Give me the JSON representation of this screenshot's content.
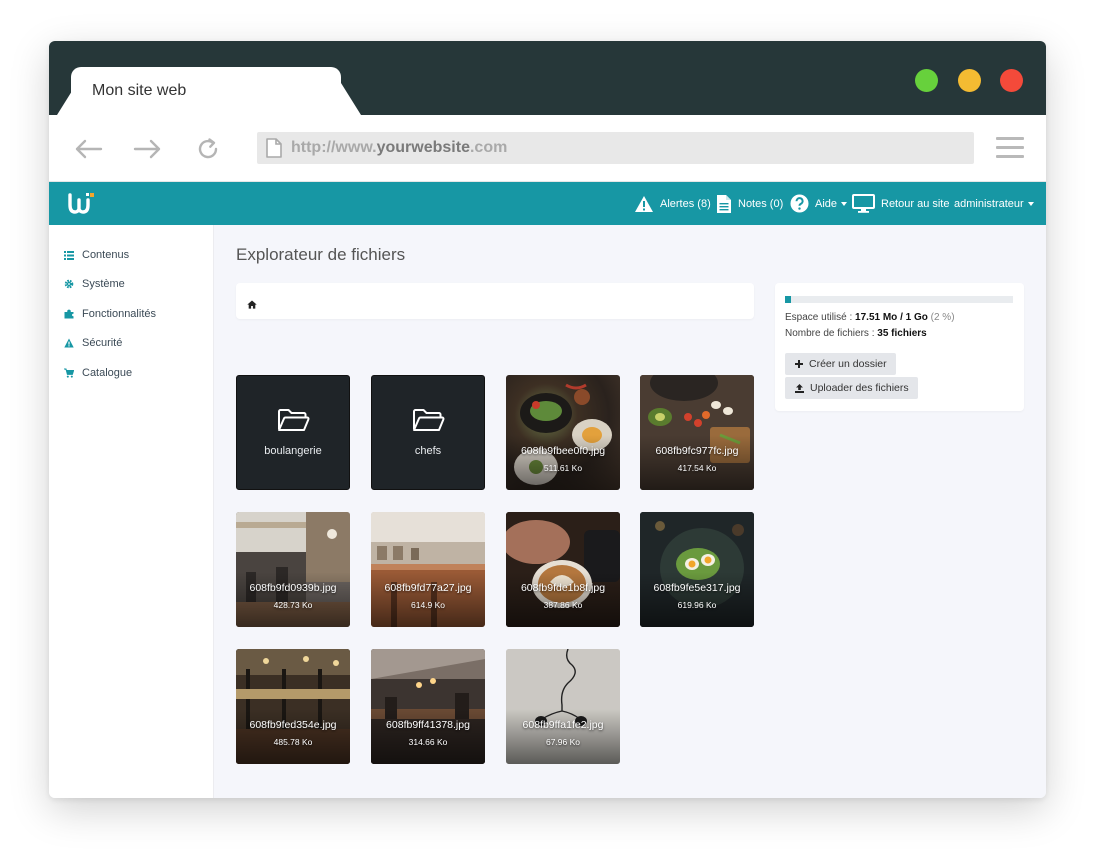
{
  "browser": {
    "tab_title": "Mon site web",
    "url_prefix": "http://www.",
    "url_domain": "yourwebsite",
    "url_suffix": ".com",
    "traffic_colors": [
      "#67d13c",
      "#f4bb32",
      "#f44a3a"
    ]
  },
  "appbar": {
    "brand_color": "#1797a4",
    "alerts_label": "Alertes (8)",
    "notes_label": "Notes (0)",
    "help_label": "Aide",
    "back_label": "Retour au site",
    "user_label": "administrateur"
  },
  "sidebar": {
    "items": [
      {
        "label": "Contenus",
        "icon": "list-icon"
      },
      {
        "label": "Système",
        "icon": "gear-icon"
      },
      {
        "label": "Fonctionnalités",
        "icon": "puzzle-icon"
      },
      {
        "label": "Sécurité",
        "icon": "warning-icon"
      },
      {
        "label": "Catalogue",
        "icon": "cart-icon"
      }
    ]
  },
  "main": {
    "title": "Explorateur de fichiers",
    "breadcrumb_icon": "home-icon"
  },
  "files": [
    {
      "type": "folder",
      "name": "boulangerie"
    },
    {
      "type": "folder",
      "name": "chefs"
    },
    {
      "type": "image",
      "name": "608fb9fbee0f0.jpg",
      "size": "511.61 Ko"
    },
    {
      "type": "image",
      "name": "608fb9fc977fc.jpg",
      "size": "417.54 Ko"
    },
    {
      "type": "image",
      "name": "608fb9fd0939b.jpg",
      "size": "428.73 Ko"
    },
    {
      "type": "image",
      "name": "608fb9fd77a27.jpg",
      "size": "614.9 Ko"
    },
    {
      "type": "image",
      "name": "608fb9fde1b8f.jpg",
      "size": "387.86 Ko"
    },
    {
      "type": "image",
      "name": "608fb9fe5e317.jpg",
      "size": "619.96 Ko"
    },
    {
      "type": "image",
      "name": "608fb9fed354e.jpg",
      "size": "485.78 Ko"
    },
    {
      "type": "image",
      "name": "608fb9ff41378.jpg",
      "size": "314.66 Ko"
    },
    {
      "type": "image",
      "name": "608fb9ffa1fe2.jpg",
      "size": "67.96 Ko"
    }
  ],
  "storage": {
    "used_prefix": "Espace utilisé : ",
    "used_value": "17.51 Mo / 1 Go",
    "used_percent_label": "(2 %)",
    "used_fraction": 0.02,
    "count_prefix": "Nombre de fichiers : ",
    "count_value": "35 fichiers",
    "create_folder_label": "Créer un dossier",
    "upload_label": "Uploader des fichiers"
  }
}
